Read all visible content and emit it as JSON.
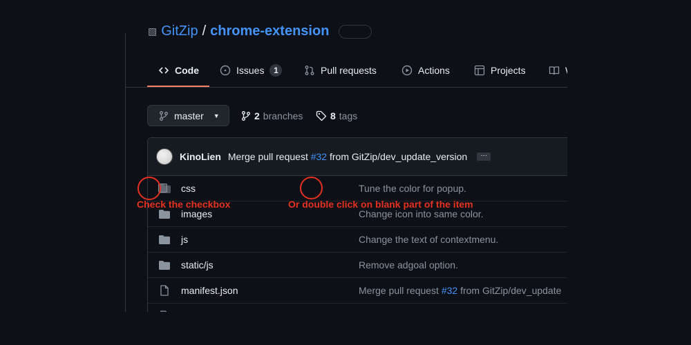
{
  "repo": {
    "owner": "GitZip",
    "separator": "/",
    "name": "chrome-extension"
  },
  "tabs": [
    {
      "label": "Code",
      "icon": "code-icon",
      "selected": true
    },
    {
      "label": "Issues",
      "icon": "issue-opened-icon",
      "count": "1"
    },
    {
      "label": "Pull requests",
      "icon": "git-pull-request-icon"
    },
    {
      "label": "Actions",
      "icon": "play-icon"
    },
    {
      "label": "Projects",
      "icon": "table-icon"
    },
    {
      "label": "W",
      "icon": "book-icon"
    }
  ],
  "branch": {
    "current": "master",
    "branches_count": "2",
    "branches_label": "branches",
    "tags_count": "8",
    "tags_label": "tags"
  },
  "latest_commit": {
    "author": "KinoLien",
    "message_prefix": "Merge pull request",
    "pr": "#32",
    "message_suffix": "from GitZip/dev_update_version",
    "more": "…"
  },
  "files": [
    {
      "type": "dir",
      "name": "css",
      "message": "Tune the color for popup."
    },
    {
      "type": "dir",
      "name": "images",
      "message": "Change icon into same color."
    },
    {
      "type": "dir",
      "name": "js",
      "message": "Change the text of contextmenu."
    },
    {
      "type": "dir",
      "name": "static/js",
      "message": "Remove adgoal option."
    },
    {
      "type": "file",
      "name": "manifest.json",
      "message_prefix": "Merge pull request",
      "pr": "#32",
      "message_suffix": "from GitZip/dev_update"
    }
  ],
  "annotations": {
    "checkbox_hint": "Check the checkbox",
    "double_click_hint": "Or double click on blank part of the item",
    "color": "#e5311f"
  },
  "colors": {
    "background": "#0d1117",
    "link": "#4493f8",
    "tab_underline": "#f78166",
    "muted": "#8b949e",
    "border": "#30363d"
  }
}
